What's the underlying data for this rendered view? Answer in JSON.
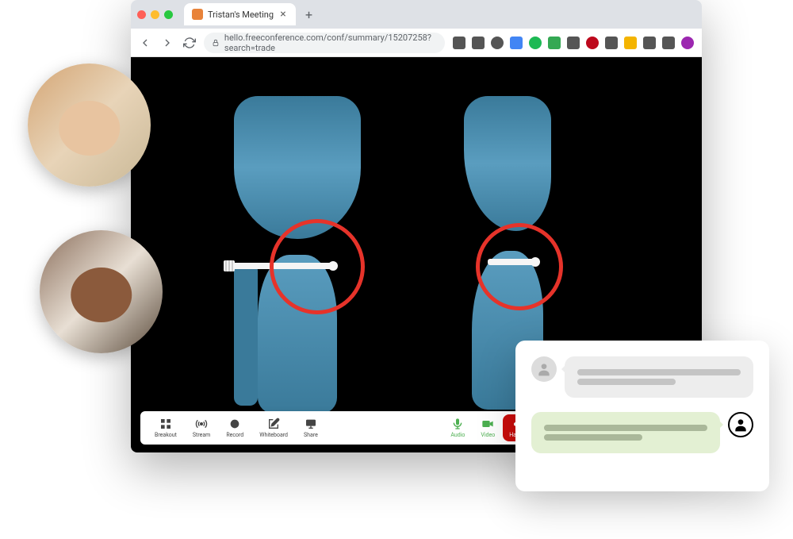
{
  "browser": {
    "tab_title": "Tristan's Meeting",
    "url": "hello.freeconference.com/conf/summary/15207258?search=trade"
  },
  "toolbar": {
    "breakout": "Breakout",
    "stream": "Stream",
    "record": "Record",
    "whiteboard": "Whiteboard",
    "share": "Share",
    "audio": "Audio",
    "video": "Video",
    "hangup": "Hang Up"
  },
  "extensions": {
    "colors": [
      "#555",
      "#555",
      "#555",
      "#4285f4",
      "#1db954",
      "#34a853",
      "#555",
      "#bd081c",
      "#555",
      "#f4b400",
      "#555",
      "#555",
      "#9c27b0"
    ]
  }
}
